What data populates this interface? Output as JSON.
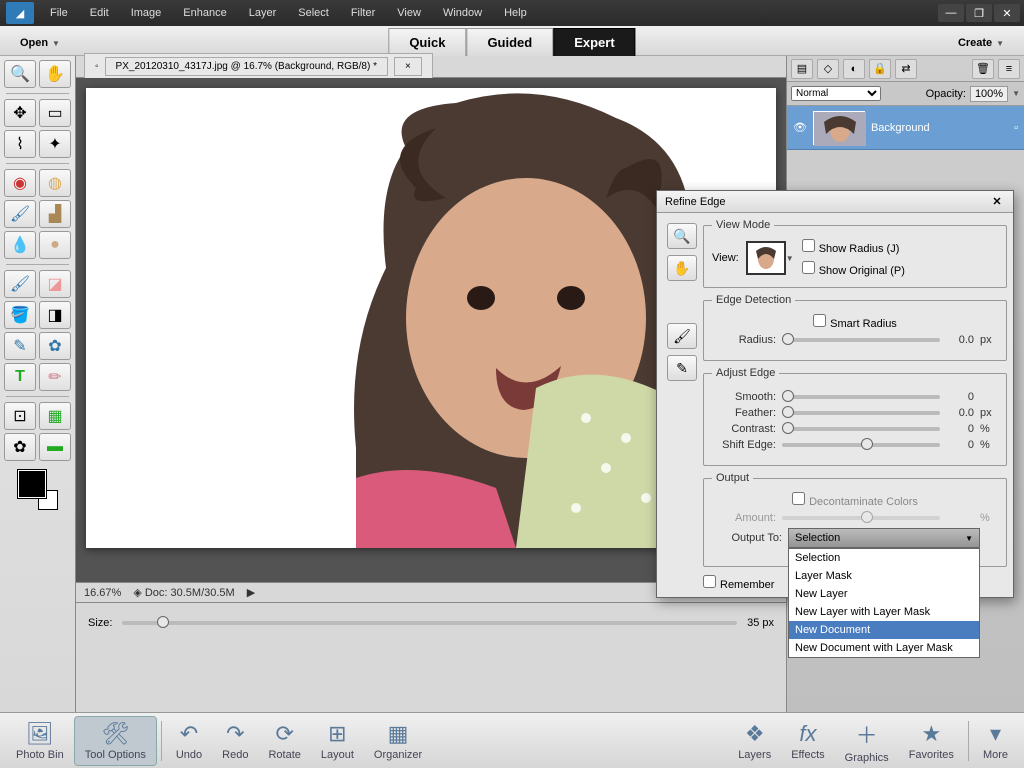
{
  "menu": {
    "file": "File",
    "edit": "Edit",
    "image": "Image",
    "enhance": "Enhance",
    "layer": "Layer",
    "select": "Select",
    "filter": "Filter",
    "view": "View",
    "window": "Window",
    "help": "Help"
  },
  "modebar": {
    "open": "Open",
    "quick": "Quick",
    "guided": "Guided",
    "expert": "Expert",
    "create": "Create"
  },
  "doc": {
    "tab": "PX_20120310_4317J.jpg @ 16.7% (Background, RGB/8) *",
    "zoom": "16.67%",
    "doc_info": "Doc: 30.5M/30.5M"
  },
  "opts": {
    "size_label": "Size:",
    "size_value": "35 px"
  },
  "right": {
    "blend": "Normal",
    "opacity_label": "Opacity:",
    "opacity_value": "100%",
    "layer": "Background"
  },
  "dialog": {
    "title": "Refine Edge",
    "view_mode": "View Mode",
    "view_label": "View:",
    "show_radius": "Show Radius (J)",
    "show_original": "Show Original (P)",
    "edge_detection": "Edge Detection",
    "smart_radius": "Smart Radius",
    "radius": "Radius:",
    "radius_val": "0.0",
    "px": "px",
    "adjust_edge": "Adjust Edge",
    "smooth": "Smooth:",
    "smooth_val": "0",
    "feather": "Feather:",
    "feather_val": "0.0",
    "contrast": "Contrast:",
    "contrast_val": "0",
    "pct": "%",
    "shift": "Shift Edge:",
    "shift_val": "0",
    "output": "Output",
    "decon": "Decontaminate Colors",
    "amount": "Amount:",
    "output_to": "Output To:",
    "out_sel": "Selection",
    "remember": "Remember",
    "opts": [
      "Selection",
      "Layer Mask",
      "New Layer",
      "New Layer with Layer Mask",
      "New Document",
      "New Document with Layer Mask"
    ]
  },
  "bottom": {
    "photo_bin": "Photo Bin",
    "tool_opts": "Tool Options",
    "undo": "Undo",
    "redo": "Redo",
    "rotate": "Rotate",
    "layout": "Layout",
    "organizer": "Organizer",
    "layers": "Layers",
    "effects": "Effects",
    "graphics": "Graphics",
    "favorites": "Favorites",
    "more": "More"
  }
}
